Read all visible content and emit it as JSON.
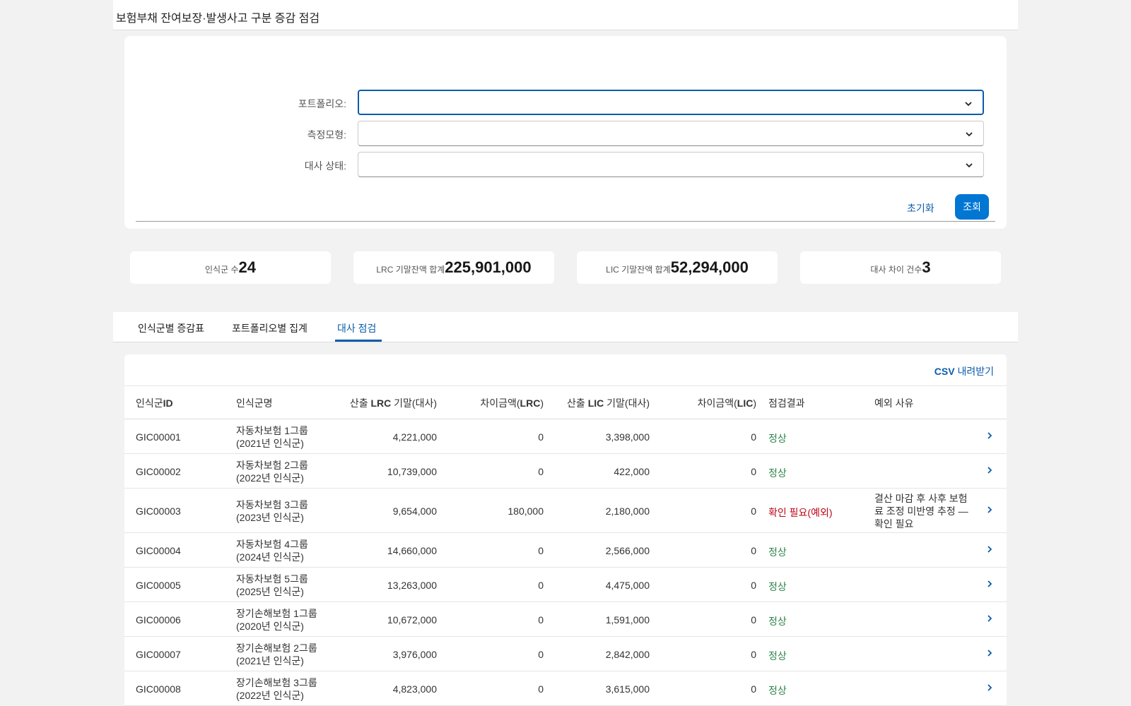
{
  "header": {
    "title": "보험부채 잔여보장·발생사고 구분 증감 점검"
  },
  "filters": [
    {
      "label": "포트폴리오:",
      "value": ""
    },
    {
      "label": "측정모형:",
      "value": ""
    },
    {
      "label": "대사 상태:",
      "value": ""
    }
  ],
  "actions": {
    "reset": "초기화",
    "search": "조회"
  },
  "kpis": [
    {
      "label": "인식군 수",
      "value": "24"
    },
    {
      "label": "LRC 기말잔액 합계",
      "value": "225,901,000"
    },
    {
      "label": "LIC 기말잔액 합계",
      "value": "52,294,000"
    },
    {
      "label": "대사 차이 건수",
      "value": "3"
    }
  ],
  "tabs": [
    {
      "label": "인식군별 증감표"
    },
    {
      "label": "포트폴리오별 집계"
    },
    {
      "label": "대사 점검",
      "active": true
    }
  ],
  "csv": {
    "prefix": "CSV",
    "label": " 내려받기"
  },
  "table": {
    "columns": [
      {
        "pre": "인식군",
        "bold": "ID",
        "post": ""
      },
      {
        "pre": "인식군명",
        "bold": "",
        "post": ""
      },
      {
        "pre": "산출 ",
        "bold": "LRC",
        "post": " 기말(대사)"
      },
      {
        "pre": "차이금액(",
        "bold": "LRC",
        "post": ")"
      },
      {
        "pre": "산출 ",
        "bold": "LIC",
        "post": " 기말(대사)"
      },
      {
        "pre": "차이금액(",
        "bold": "LIC",
        "post": ")"
      },
      {
        "pre": "점검결과",
        "bold": "",
        "post": ""
      },
      {
        "pre": "예외 사유",
        "bold": "",
        "post": ""
      }
    ],
    "rows": [
      {
        "id": "GIC00001",
        "name1": "자동차보험 1그룹",
        "name2": "(2021년 인식군)",
        "lrc": "4,221,000",
        "dlrc": "0",
        "lic": "3,398,000",
        "dlic": "0",
        "result": "정상",
        "status": "ok",
        "exception": ""
      },
      {
        "id": "GIC00002",
        "name1": "자동차보험 2그룹",
        "name2": "(2022년 인식군)",
        "lrc": "10,739,000",
        "dlrc": "0",
        "lic": "422,000",
        "dlic": "0",
        "result": "정상",
        "status": "ok",
        "exception": ""
      },
      {
        "id": "GIC00003",
        "name1": "자동차보험 3그룹",
        "name2": "(2023년 인식군)",
        "lrc": "9,654,000",
        "dlrc": "180,000",
        "lic": "2,180,000",
        "dlic": "0",
        "result": "확인 필요(예외)",
        "status": "warn",
        "exception": "결산 마감 후 사후 보험료 조정 미반영 추정 — 확인 필요"
      },
      {
        "id": "GIC00004",
        "name1": "자동차보험 4그룹",
        "name2": "(2024년 인식군)",
        "lrc": "14,660,000",
        "dlrc": "0",
        "lic": "2,566,000",
        "dlic": "0",
        "result": "정상",
        "status": "ok",
        "exception": ""
      },
      {
        "id": "GIC00005",
        "name1": "자동차보험 5그룹",
        "name2": "(2025년 인식군)",
        "lrc": "13,263,000",
        "dlrc": "0",
        "lic": "4,475,000",
        "dlic": "0",
        "result": "정상",
        "status": "ok",
        "exception": ""
      },
      {
        "id": "GIC00006",
        "name1": "장기손해보험 1그룹",
        "name2": "(2020년 인식군)",
        "lrc": "10,672,000",
        "dlrc": "0",
        "lic": "1,591,000",
        "dlic": "0",
        "result": "정상",
        "status": "ok",
        "exception": ""
      },
      {
        "id": "GIC00007",
        "name1": "장기손해보험 2그룹",
        "name2": "(2021년 인식군)",
        "lrc": "3,976,000",
        "dlrc": "0",
        "lic": "2,842,000",
        "dlic": "0",
        "result": "정상",
        "status": "ok",
        "exception": ""
      },
      {
        "id": "GIC00008",
        "name1": "장기손해보험 3그룹",
        "name2": "(2022년 인식군)",
        "lrc": "4,823,000",
        "dlrc": "0",
        "lic": "3,615,000",
        "dlic": "0",
        "result": "정상",
        "status": "ok",
        "exception": ""
      }
    ]
  },
  "colors": {
    "accent": "#0176d3",
    "link": "#0b5cab",
    "ok": "#2e844a",
    "warn": "#ba0517"
  },
  "icons": {
    "select": "chevron-down-icon",
    "row": "chevron-right-icon"
  }
}
